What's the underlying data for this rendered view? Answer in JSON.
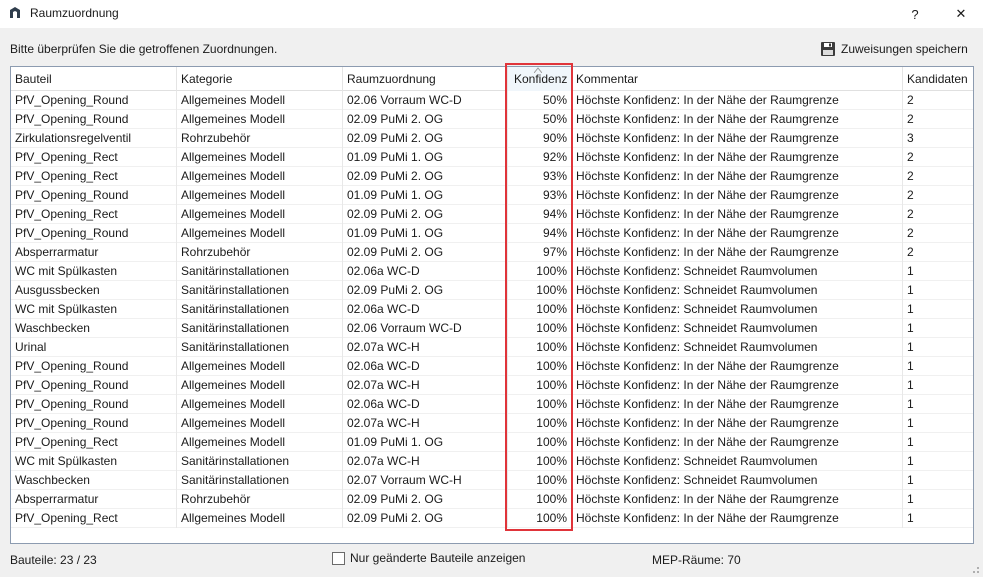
{
  "window": {
    "title": "Raumzuordnung",
    "help_label": "?",
    "close_label": "✕"
  },
  "instruction": "Bitte überprüfen Sie die getroffenen Zuordnungen.",
  "toolbar": {
    "save_label": "Zuweisungen speichern",
    "save_icon": "floppy-disk-icon"
  },
  "table": {
    "columns": [
      "Bauteil",
      "Kategorie",
      "Raumzuordnung",
      "Konfidenz",
      "Kommentar",
      "Kandidaten"
    ],
    "sorted_column": "Konfidenz",
    "sort_direction": "ascending",
    "rows": [
      [
        "PfV_Opening_Round",
        "Allgemeines Modell",
        "02.06 Vorraum WC-D",
        "50%",
        "Höchste Konfidenz: In der Nähe der Raumgrenze",
        "2"
      ],
      [
        "PfV_Opening_Round",
        "Allgemeines Modell",
        "02.09 PuMi 2. OG",
        "50%",
        "Höchste Konfidenz: In der Nähe der Raumgrenze",
        "2"
      ],
      [
        "Zirkulationsregelventil",
        "Rohrzubehör",
        "02.09 PuMi 2. OG",
        "90%",
        "Höchste Konfidenz: In der Nähe der Raumgrenze",
        "3"
      ],
      [
        "PfV_Opening_Rect",
        "Allgemeines Modell",
        "01.09 PuMi 1. OG",
        "92%",
        "Höchste Konfidenz: In der Nähe der Raumgrenze",
        "2"
      ],
      [
        "PfV_Opening_Rect",
        "Allgemeines Modell",
        "02.09 PuMi 2. OG",
        "93%",
        "Höchste Konfidenz: In der Nähe der Raumgrenze",
        "2"
      ],
      [
        "PfV_Opening_Round",
        "Allgemeines Modell",
        "01.09 PuMi 1. OG",
        "93%",
        "Höchste Konfidenz: In der Nähe der Raumgrenze",
        "2"
      ],
      [
        "PfV_Opening_Rect",
        "Allgemeines Modell",
        "02.09 PuMi 2. OG",
        "94%",
        "Höchste Konfidenz: In der Nähe der Raumgrenze",
        "2"
      ],
      [
        "PfV_Opening_Round",
        "Allgemeines Modell",
        "01.09 PuMi 1. OG",
        "94%",
        "Höchste Konfidenz: In der Nähe der Raumgrenze",
        "2"
      ],
      [
        "Absperrarmatur",
        "Rohrzubehör",
        "02.09 PuMi 2. OG",
        "97%",
        "Höchste Konfidenz: In der Nähe der Raumgrenze",
        "2"
      ],
      [
        "WC mit Spülkasten",
        "Sanitärinstallationen",
        "02.06a WC-D",
        "100%",
        "Höchste Konfidenz: Schneidet Raumvolumen",
        "1"
      ],
      [
        "Ausgussbecken",
        "Sanitärinstallationen",
        "02.09 PuMi 2. OG",
        "100%",
        "Höchste Konfidenz: Schneidet Raumvolumen",
        "1"
      ],
      [
        "WC mit Spülkasten",
        "Sanitärinstallationen",
        "02.06a WC-D",
        "100%",
        "Höchste Konfidenz: Schneidet Raumvolumen",
        "1"
      ],
      [
        "Waschbecken",
        "Sanitärinstallationen",
        "02.06 Vorraum WC-D",
        "100%",
        "Höchste Konfidenz: Schneidet Raumvolumen",
        "1"
      ],
      [
        "Urinal",
        "Sanitärinstallationen",
        "02.07a WC-H",
        "100%",
        "Höchste Konfidenz: Schneidet Raumvolumen",
        "1"
      ],
      [
        "PfV_Opening_Round",
        "Allgemeines Modell",
        "02.06a WC-D",
        "100%",
        "Höchste Konfidenz: In der Nähe der Raumgrenze",
        "1"
      ],
      [
        "PfV_Opening_Round",
        "Allgemeines Modell",
        "02.07a WC-H",
        "100%",
        "Höchste Konfidenz: In der Nähe der Raumgrenze",
        "1"
      ],
      [
        "PfV_Opening_Round",
        "Allgemeines Modell",
        "02.06a WC-D",
        "100%",
        "Höchste Konfidenz: In der Nähe der Raumgrenze",
        "1"
      ],
      [
        "PfV_Opening_Round",
        "Allgemeines Modell",
        "02.07a WC-H",
        "100%",
        "Höchste Konfidenz: In der Nähe der Raumgrenze",
        "1"
      ],
      [
        "PfV_Opening_Rect",
        "Allgemeines Modell",
        "01.09 PuMi 1. OG",
        "100%",
        "Höchste Konfidenz: In der Nähe der Raumgrenze",
        "1"
      ],
      [
        "WC mit Spülkasten",
        "Sanitärinstallationen",
        "02.07a WC-H",
        "100%",
        "Höchste Konfidenz: Schneidet Raumvolumen",
        "1"
      ],
      [
        "Waschbecken",
        "Sanitärinstallationen",
        "02.07 Vorraum WC-H",
        "100%",
        "Höchste Konfidenz: Schneidet Raumvolumen",
        "1"
      ],
      [
        "Absperrarmatur",
        "Rohrzubehör",
        "02.09 PuMi 2. OG",
        "100%",
        "Höchste Konfidenz: In der Nähe der Raumgrenze",
        "1"
      ],
      [
        "PfV_Opening_Rect",
        "Allgemeines Modell",
        "02.09 PuMi 2. OG",
        "100%",
        "Höchste Konfidenz: In der Nähe der Raumgrenze",
        "1"
      ]
    ]
  },
  "status": {
    "count_label": "Bauteile: 23 / 23",
    "filter_checkbox_label": "Nur geänderte Bauteile anzeigen",
    "filter_checked": false,
    "rooms_label": "MEP-Räume: 70"
  },
  "colors": {
    "highlight": "#e0343a",
    "grid_border": "#8c9bb0"
  }
}
